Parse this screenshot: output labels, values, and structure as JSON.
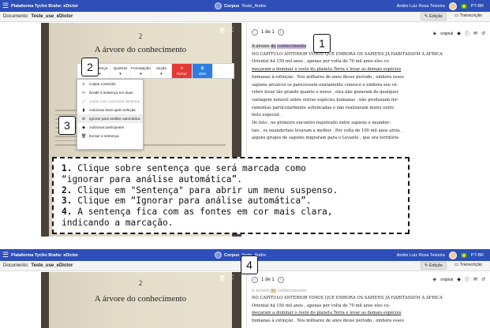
{
  "app": {
    "brand": "Plataforma Tycho Brahe: eDictor",
    "corpus_label": "Corpus",
    "corpus_name": "Teste_Andre",
    "user_name": "Andre Luiz Rosa Teixeira",
    "locale": "PT-BR"
  },
  "document": {
    "label": "Documento:",
    "name": "Teste_use_eDictor",
    "tab_edit": "Edição",
    "tab_transcription": "Transcrição"
  },
  "page_image": {
    "page_number": "2",
    "title": "A árvore do conhecimento"
  },
  "toolbar": {
    "sentence": "Sentença",
    "lines": "Quebras",
    "formatting": "Formatação",
    "section": "Seção",
    "close": "fechar",
    "open": "abrir"
  },
  "sentence_menu": {
    "items": [
      {
        "icon": "≡",
        "label": "Copiar conteúdo",
        "disabled": false
      },
      {
        "icon": "✂",
        "label": "Dividir a sentença em duas",
        "disabled": false
      },
      {
        "icon": "⤢",
        "label": "Juntar com a próxima sentença",
        "disabled": true
      },
      {
        "icon": "▮",
        "label": "Adicionar texto após seleção",
        "disabled": false
      },
      {
        "icon": "⊘",
        "label": "Ignorar para análise automática",
        "disabled": false
      },
      {
        "icon": "◆",
        "label": "Adicionar participante",
        "disabled": false
      },
      {
        "icon": "🗑",
        "label": "Excluir a sentença",
        "disabled": false
      }
    ]
  },
  "text_panel": {
    "page_indicator": "1 de 1",
    "original_label": "original",
    "heading_word": "A árvore",
    "heading_do": "do",
    "heading_rest": "conhecimento",
    "lines_top": [
      "NO CAPÍTULO ANTERIOR VIMOS QUE EMBORA OS SAPIENS JÁ HABITASSEM A ÁFRICA",
      "Oriental há 150 mil anos , apenas por volta de 70 mil anos eles co-",
      "meçaram a dominar o resto do planeta Terra e levar as demais espécies",
      "humanas à extinção . Nos milhares de anos desse período , embora esses",
      "sapiens arcaicos se parecessem exatamente conosco e embora seu cé-",
      "rebro fosse tão grande quanto o nosso , eles não gozavam de qualquer",
      "vantagem notável sobre outras espécies humanas , não produziam fer-",
      "ramentas particularmente sofisticadas e não realizavam muito outro",
      "feito especial .",
      "De fato , no primeiro encontro registrado entre sapiens e neander-",
      "tais , os neandertais levaram a melhor . Por volta de 100 mil anos atrás ,",
      "alguns grupos de sapiens migraram para o Levante , que era território"
    ],
    "lines_bottom": [
      "NO CAPÍTULO ANTERIOR VIMOS QUE EMBORA OS SAPIENS JÁ HABITASSEM A ÁFRICA",
      "Oriental há 150 mil anos , apenas por volta de 70 mil anos eles co-",
      "meçaram a dominar o resto do planeta Terra e levar as demais espécies",
      "humanas à extinção . Nos milhares de anos desse período , embora esses"
    ]
  },
  "markers": [
    "1",
    "2",
    "3",
    "4"
  ],
  "instructions": [
    {
      "num": "1.",
      "text": " Clique sobre sentença que será marcada como"
    },
    {
      "num": "",
      "text": "“ignorar para análise automática”."
    },
    {
      "num": "2.",
      "text": " Clique em \"Sentença\" para abrir um menu suspenso."
    },
    {
      "num": "3.",
      "text": " Clique em “Ignorar para análise automática”."
    },
    {
      "num": "4.",
      "text": " A sentença fica com as fontes em cor mais clara,"
    },
    {
      "num": "",
      "text": "indicando a marcação."
    }
  ],
  "colors": {
    "topbar": "#2e4fb8",
    "close_button": "#e53935",
    "open_button": "#2e7de0",
    "highlight_selected": "#c7b8e0"
  }
}
